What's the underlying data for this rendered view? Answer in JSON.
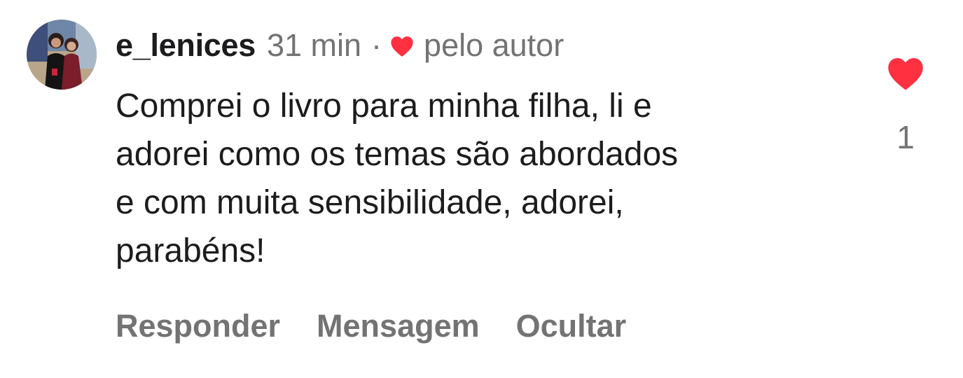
{
  "comment": {
    "username": "e_lenices",
    "time": "31 min",
    "separator": "·",
    "liked_by_author_label": "pelo autor",
    "text_lines": [
      "Comprei o livro para minha filha, li e",
      "adorei como os temas são abordados",
      "e com muita sensibilidade, adorei,",
      "parabéns!"
    ],
    "actions": {
      "reply": "Responder",
      "message": "Mensagem",
      "hide": "Ocultar"
    },
    "like_count": "1"
  },
  "icons": {
    "author_heart": "heart-icon",
    "like": "heart-icon"
  },
  "colors": {
    "heart": "#ff3040",
    "primary_text": "#1c1c1e",
    "secondary_text": "#737373"
  }
}
